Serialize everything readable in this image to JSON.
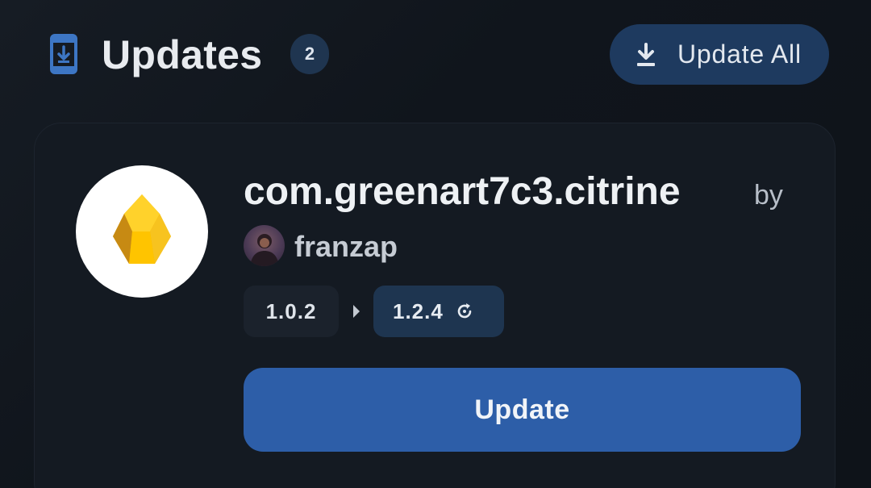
{
  "header": {
    "icon": "phone-download-icon",
    "title": "Updates",
    "count": "2",
    "update_all_icon": "download-icon",
    "update_all_label": "Update All"
  },
  "app": {
    "icon": "citrine-gem-icon",
    "name": "com.greenart7c3.citrine",
    "by_label": "by",
    "author_avatar": "author-avatar",
    "author": "franzap",
    "current_version": "1.0.2",
    "arrow_icon": "caret-right-icon",
    "new_version": "1.2.4",
    "new_version_icon": "refresh-icon",
    "update_label": "Update"
  },
  "colors": {
    "background": "#10151c",
    "card": "#141a22",
    "accent": "#2d5ea8",
    "badge": "#1f3550",
    "primary_icon": "#3d76c4"
  }
}
